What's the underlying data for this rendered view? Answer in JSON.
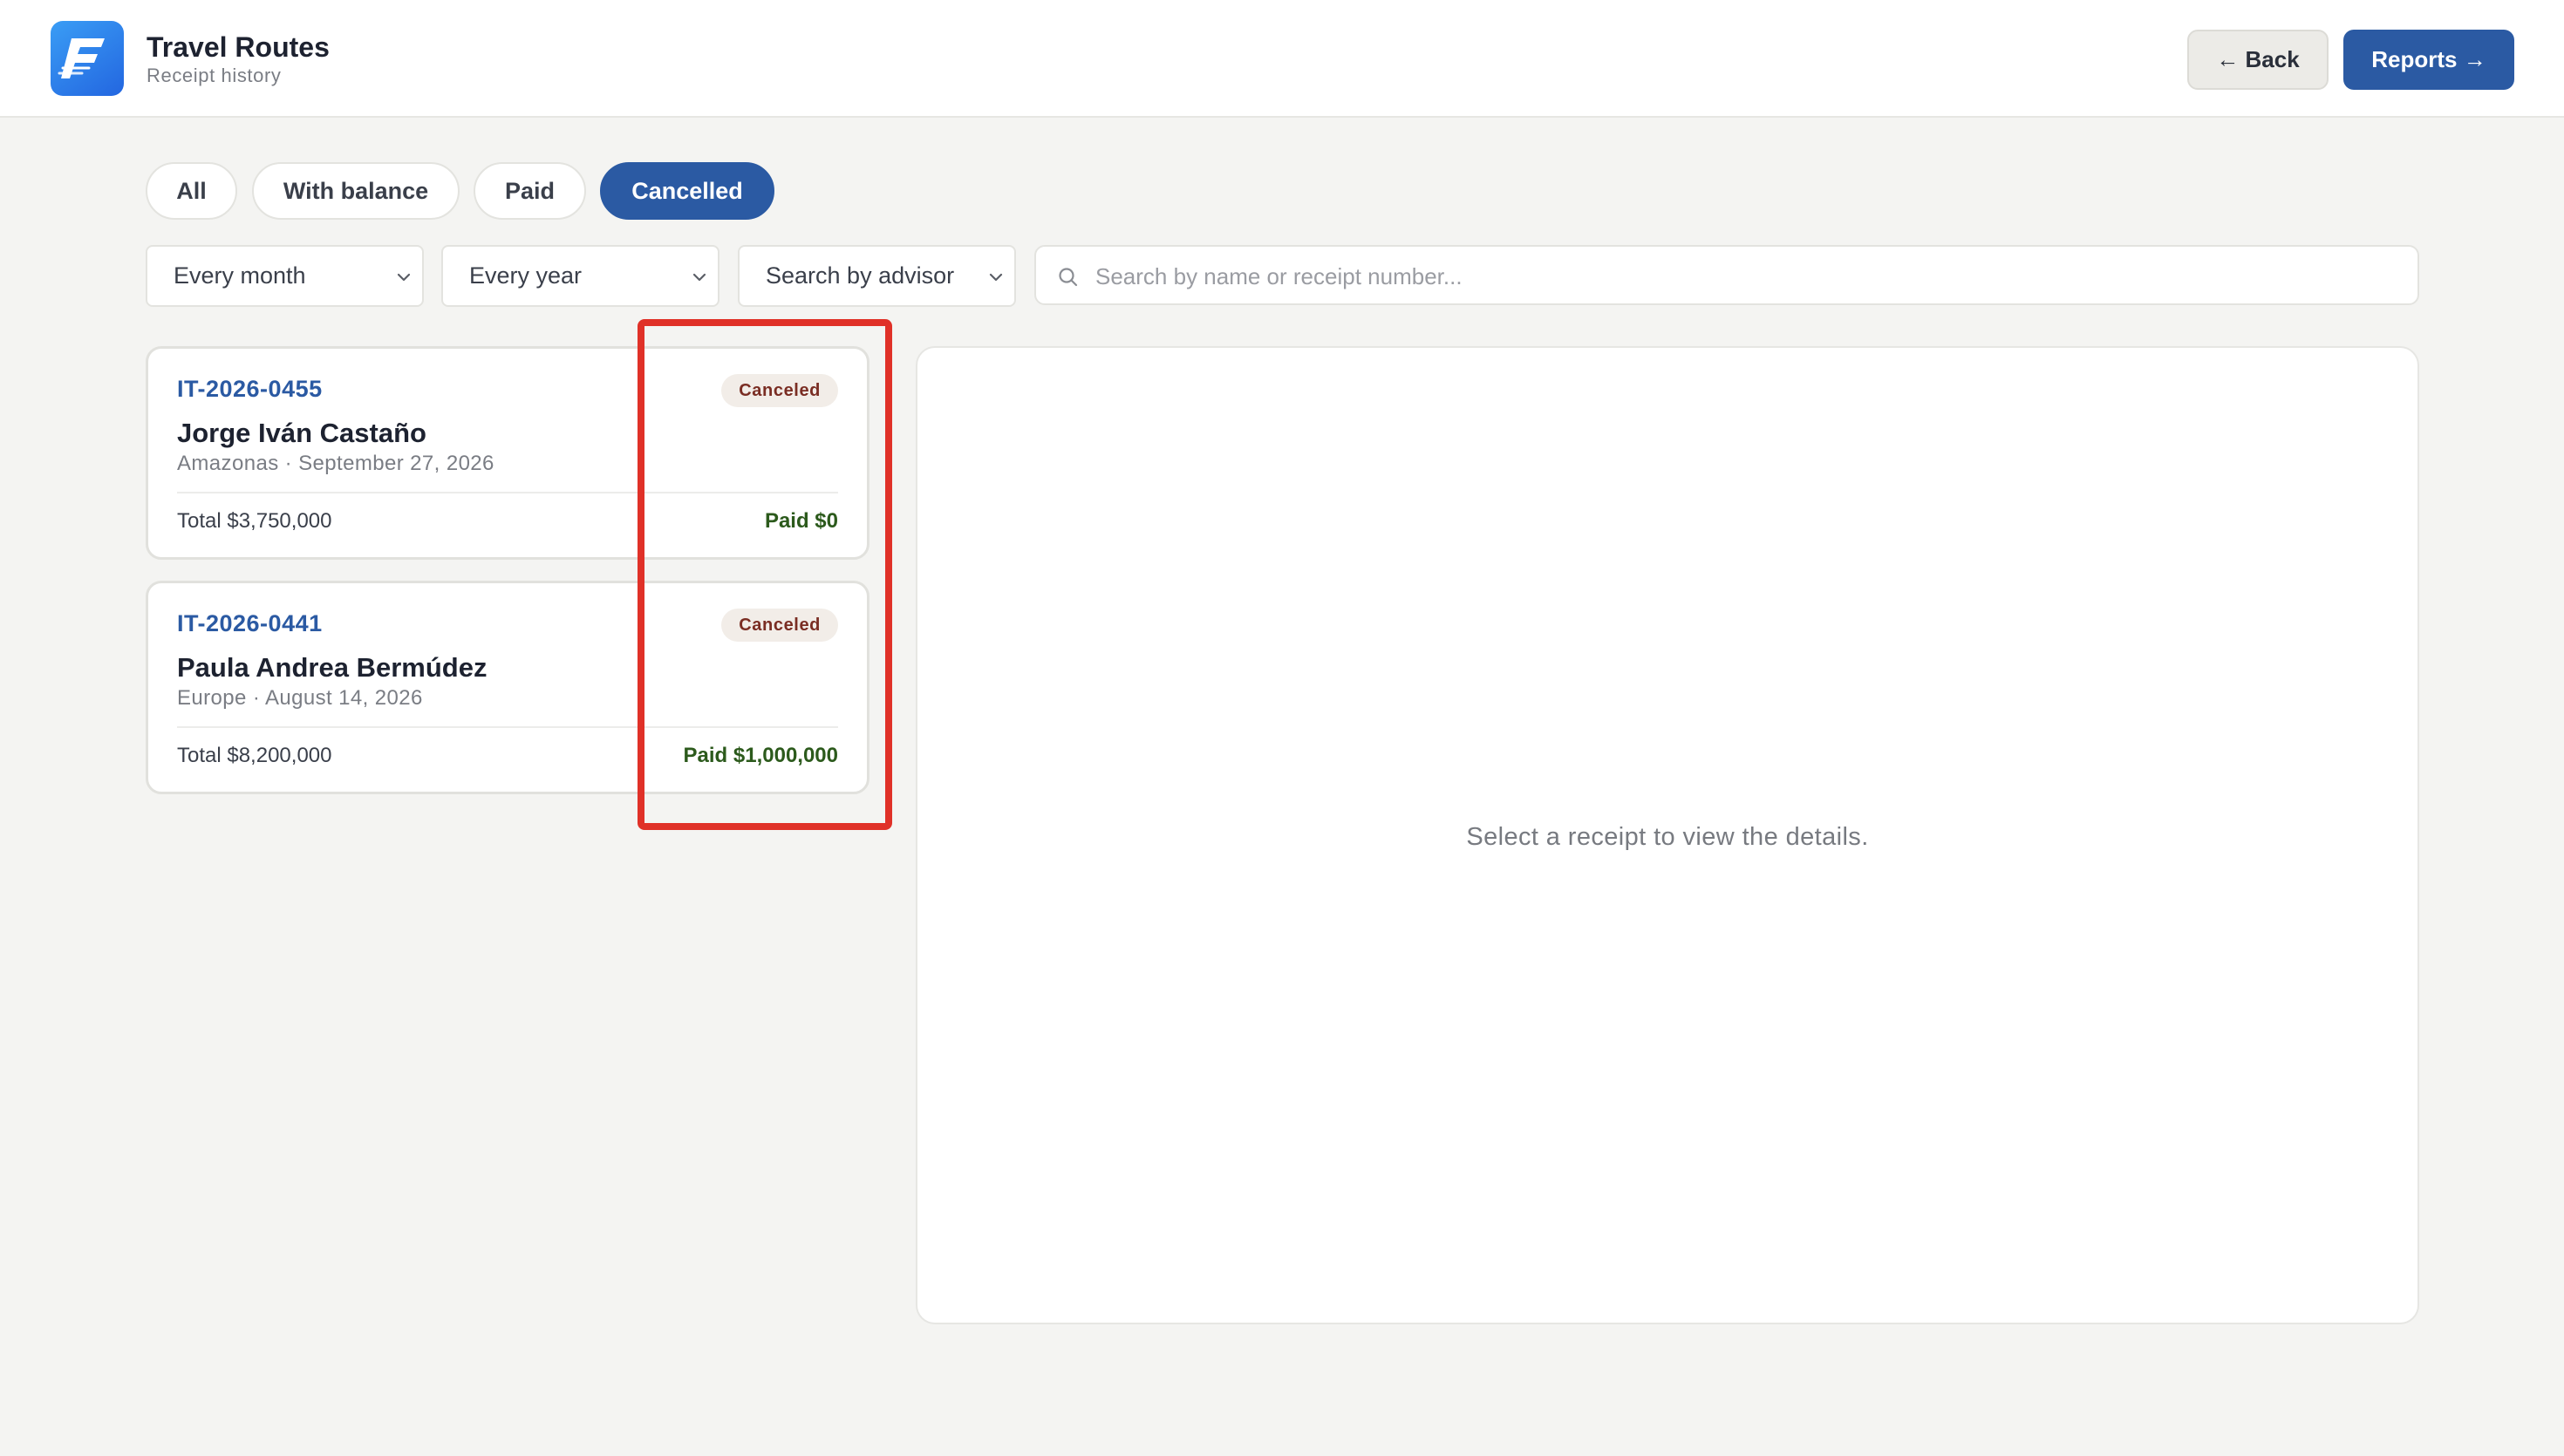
{
  "header": {
    "logo_icon": "airline-swoosh-logo",
    "title": "Travel Routes",
    "subtitle": "Receipt history",
    "back_label": "← Back",
    "reports_label": "Reports →"
  },
  "tabs": [
    {
      "label": "All",
      "active": false
    },
    {
      "label": "With balance",
      "active": false
    },
    {
      "label": "Paid",
      "active": false
    },
    {
      "label": "Cancelled",
      "active": true
    }
  ],
  "filters": {
    "month": {
      "selected": "Every month",
      "icon": "chevron-down-icon"
    },
    "year": {
      "selected": "Every year",
      "icon": "chevron-down-icon"
    },
    "advisor": {
      "selected": "Search by advisor",
      "icon": "chevron-down-icon"
    },
    "search": {
      "value": "",
      "placeholder": "Search by name or receipt number...",
      "icon": "search-icon"
    }
  },
  "receipts": [
    {
      "id": "IT-2026-0455",
      "status": "Canceled",
      "name": "Jorge Iván Castaño",
      "meta": "Amazonas · September 27, 2026",
      "total": "Total $3,750,000",
      "paid": "Paid $0"
    },
    {
      "id": "IT-2026-0441",
      "status": "Canceled",
      "name": "Paula Andrea Bermúdez",
      "meta": "Europe · August 14, 2026",
      "total": "Total $8,200,000",
      "paid": "Paid $1,000,000"
    }
  ],
  "detail": {
    "empty_message": "Select a receipt to view the details."
  },
  "colors": {
    "accent": "#2b5aa3",
    "highlight": "#e03128",
    "badge_text": "#7a2d23",
    "paid_text": "#2c5a1c",
    "background": "#f4f4f2"
  }
}
